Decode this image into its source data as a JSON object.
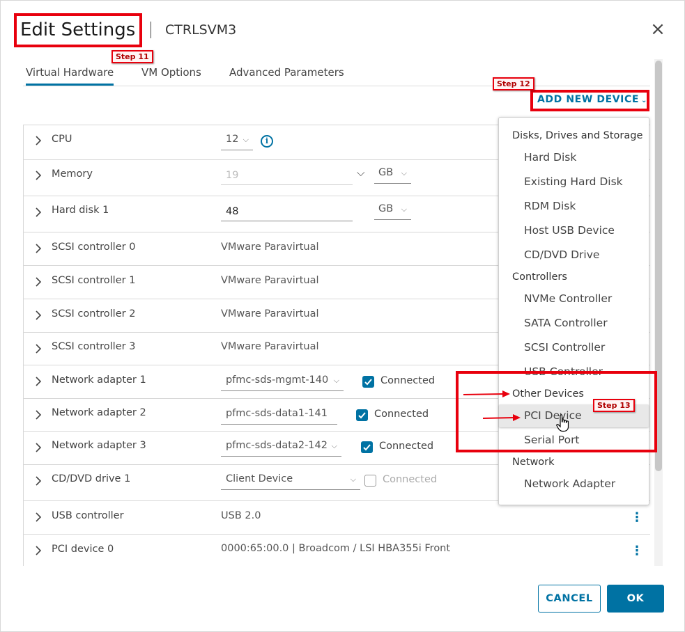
{
  "header": {
    "title": "Edit Settings",
    "vm_name": "CTRLSVM3",
    "close_glyph": "×"
  },
  "tabs": [
    {
      "label": "Virtual Hardware",
      "active": true
    },
    {
      "label": "VM Options",
      "active": false
    },
    {
      "label": "Advanced Parameters",
      "active": false
    }
  ],
  "toolbar": {
    "add_new_device_label": "ADD NEW DEVICE",
    "add_new_device_chevron": "⌄"
  },
  "hardware_rows": [
    {
      "label": "CPU",
      "value": "12",
      "control": "select"
    },
    {
      "label": "Memory",
      "value": "19",
      "unit": "GB",
      "control": "input-disabled"
    },
    {
      "label": "Hard disk 1",
      "value": "48",
      "unit": "GB",
      "control": "input"
    },
    {
      "label": "SCSI controller 0",
      "value": "VMware Paravirtual"
    },
    {
      "label": "SCSI controller 1",
      "value": "VMware Paravirtual"
    },
    {
      "label": "SCSI controller 2",
      "value": "VMware Paravirtual"
    },
    {
      "label": "SCSI controller 3",
      "value": "VMware Paravirtual"
    },
    {
      "label": "Network adapter 1",
      "value": "pfmc-sds-mgmt-140",
      "connected_label": "Connected",
      "connected": true
    },
    {
      "label": "Network adapter 2",
      "value": "pfmc-sds-data1-141",
      "connected_label": "Connected",
      "connected": true
    },
    {
      "label": "Network adapter 3",
      "value": "pfmc-sds-data2-142",
      "connected_label": "Connected",
      "connected": true
    },
    {
      "label": "CD/DVD drive 1",
      "value": "Client Device",
      "connected_label": "Connected",
      "connected": false
    },
    {
      "label": "USB controller",
      "value": "USB 2.0"
    },
    {
      "label": "PCI device 0",
      "value": "0000:65:00.0 | Broadcom / LSI HBA355i Front"
    }
  ],
  "dropdown": {
    "groups": [
      {
        "name": "Disks, Drives and Storage",
        "items": [
          "Hard Disk",
          "Existing Hard Disk",
          "RDM Disk",
          "Host USB Device",
          "CD/DVD Drive"
        ]
      },
      {
        "name": "Controllers",
        "items": [
          "NVMe Controller",
          "SATA Controller",
          "SCSI Controller",
          "USB Controller"
        ]
      },
      {
        "name": "Other Devices",
        "items": [
          "PCI Device",
          "Serial Port"
        ]
      },
      {
        "name": "Network",
        "items": [
          "Network Adapter"
        ]
      }
    ],
    "hovered_item": "PCI Device"
  },
  "annotations": {
    "step11": "Step 11",
    "step12": "Step 12",
    "step13": "Step 13",
    "color": "#e8000d"
  },
  "footer": {
    "cancel_label": "CANCEL",
    "ok_label": "OK"
  },
  "colors": {
    "accent": "#0072a3",
    "annotation_red": "#e8000d"
  },
  "icons": {
    "close": "close-icon",
    "info": "info-icon",
    "row_expand": "chevron-right-icon",
    "kebab": "vertical-ellipsis-icon",
    "checkbox": "checkmark-icon",
    "pointer": "hand-pointer-icon"
  }
}
